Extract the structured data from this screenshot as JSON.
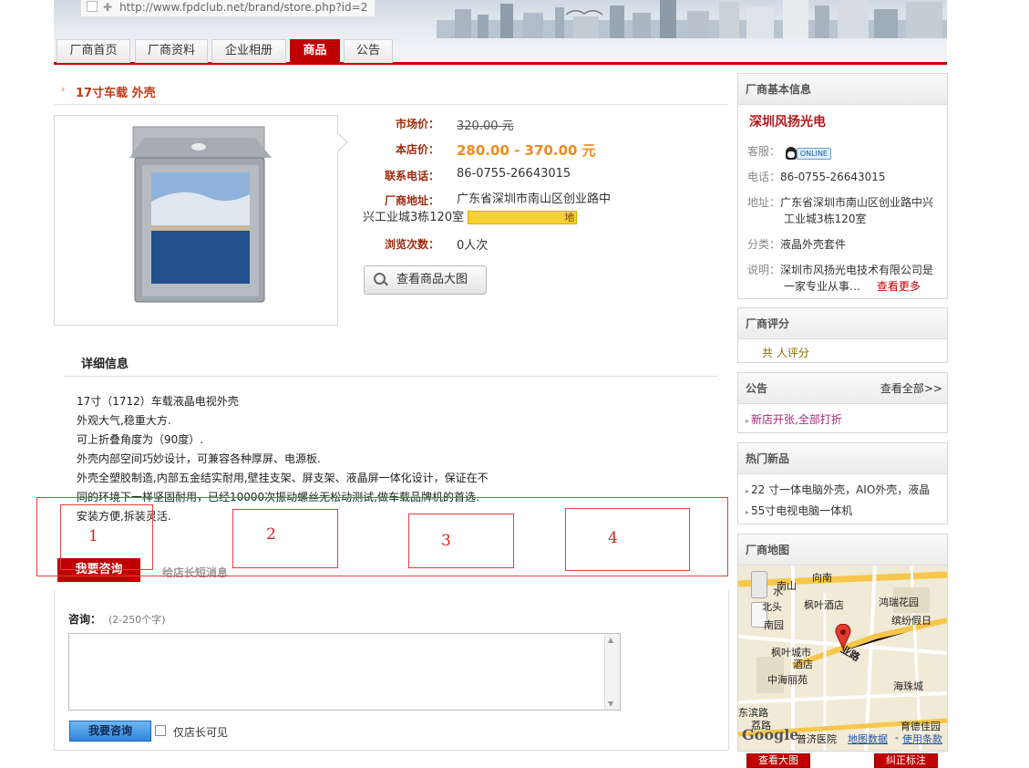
{
  "browser": {
    "url": "http://www.fpdclub.net/brand/store.php?id=2"
  },
  "nav": {
    "tabs": [
      "厂商首页",
      "厂商资料",
      "企业相册",
      "商品",
      "公告"
    ],
    "active": "商品"
  },
  "product": {
    "title": "17寸车载 外壳",
    "labels": {
      "market": "市场价：",
      "store": "本店价：",
      "phone": "联系电话：",
      "address": "厂商地址：",
      "views": "浏览次数："
    },
    "market_price": "320.00 元",
    "store_price": "280.00 - 370.00 元",
    "phone": "86-0755-26643015",
    "address": "广东省深圳市南山区创业路中兴工业城3栋120室",
    "map_badge": "地",
    "views": "0人次",
    "view_large_label": "查看商品大图"
  },
  "details": {
    "title": "详细信息",
    "lines": [
      "17寸（1712）车载液晶电视外壳",
      "外观大气,稳重大方.",
      "可上折叠角度为（90度）.",
      "外壳内部空间巧妙设计，可兼容各种厚屏、电源板.",
      "外壳全塑胶制造,内部五金结实耐用,壁挂支架、屏支架、液晶屏一体化设计，保证在不",
      "同的环境下一样坚固耐用，已经10000次振动螺丝无松动测试,做车载品牌机的首选.",
      "安装方便,拆装灵活."
    ]
  },
  "annotations": [
    "1",
    "2",
    "3",
    "4"
  ],
  "consult": {
    "tab_active": "我要咨询",
    "tab_other": "给店长短消息",
    "label": "咨询：",
    "hint": "(2-250个字)",
    "submit": "我要咨询",
    "owner_only": "仅店长可见"
  },
  "sidebar": {
    "vendor": {
      "header": "厂商基本信息",
      "name": "深圳风扬光电",
      "service_key": "客服：",
      "online": "ONLINE",
      "phone_key": "电话：",
      "phone": "86-0755-26643015",
      "addr_key": "地址：",
      "addr_line1": "广东省深圳市南山区创业路中兴",
      "addr_line2": "工业城3栋120室",
      "cat_key": "分类：",
      "category": "液晶外壳套件",
      "desc_key": "说明：",
      "desc_line1": "深圳市风扬光电技术有限公司是",
      "desc_line2": "一家专业从事…",
      "more": "查看更多"
    },
    "rating": {
      "header": "厂商评分",
      "text": "共 人评分"
    },
    "notice": {
      "header": "公告",
      "more": "查看全部>>",
      "items": [
        "新店开张,全部打折"
      ]
    },
    "hot": {
      "header": "热门新品",
      "items": [
        "22 寸一体电脑外壳，AIO外壳，液晶",
        "55寸电视电脑一体机"
      ]
    },
    "map": {
      "header": "厂商地图",
      "labels": [
        "南山",
        "向南",
        "北头",
        "枫叶酒店",
        "鸿瑞花园",
        "南园",
        "缤纷假日",
        "枫叶城市",
        "酒店",
        "业路",
        "中海丽苑",
        "海珠城",
        "东滨路",
        "育德佳园",
        "普济医院",
        "荔路",
        "水"
      ],
      "google": "Google",
      "link1": "地图数据",
      "sep": "-",
      "link2": "使用条款"
    },
    "bottom_btn1": "查看大图",
    "bottom_btn2": "纠正标注"
  }
}
